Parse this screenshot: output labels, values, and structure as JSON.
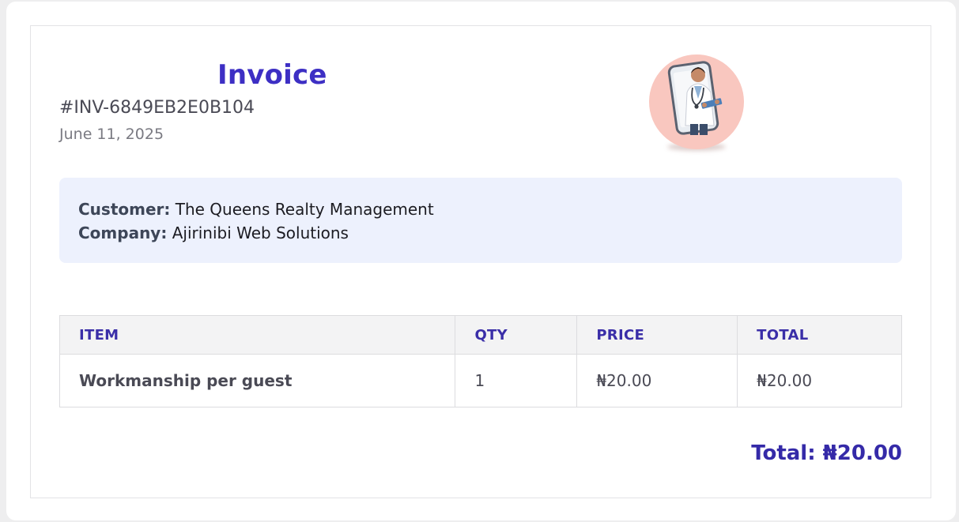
{
  "invoice": {
    "title": "Invoice",
    "number": "#INV-6849EB2E0B104",
    "date": "June 11, 2025"
  },
  "customer": {
    "customer_label": "Customer:",
    "customer_name": "The Queens Realty Management",
    "company_label": "Company:",
    "company_name": "Ajirinibi Web Solutions"
  },
  "table": {
    "headers": [
      "ITEM",
      "QTY",
      "PRICE",
      "TOTAL"
    ],
    "rows": [
      {
        "item": "Workmanship per guest",
        "qty": "1",
        "price": "₦20.00",
        "total": "₦20.00"
      }
    ]
  },
  "summary": {
    "total_text": "Total: ₦20.00"
  },
  "colors": {
    "accent": "#3d2fc4",
    "info_bg": "#edf1fd",
    "avatar_bg": "#f9c7bf"
  }
}
